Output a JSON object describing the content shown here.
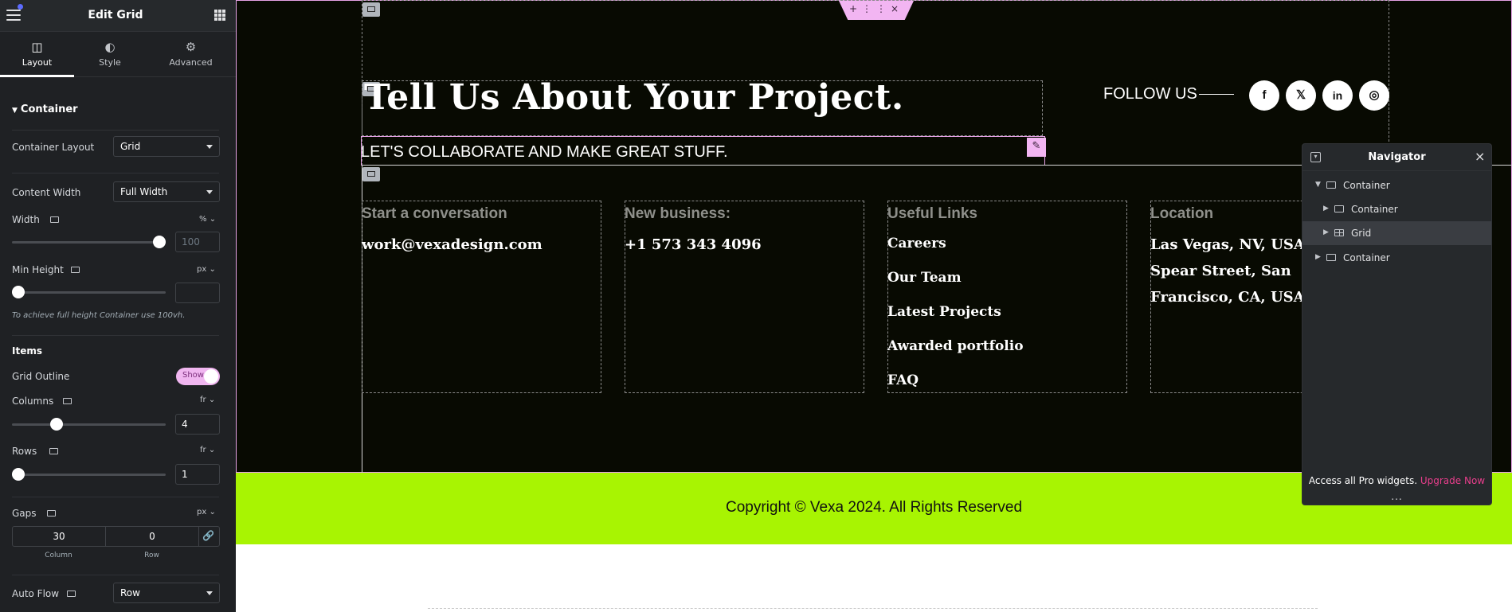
{
  "panel": {
    "title": "Edit Grid",
    "tabs": [
      {
        "label": "Layout",
        "icon": "layout-icon",
        "active": true
      },
      {
        "label": "Style",
        "icon": "style-icon",
        "active": false
      },
      {
        "label": "Advanced",
        "icon": "gear-icon",
        "active": false
      }
    ],
    "section_title": "Container",
    "container_layout": {
      "label": "Container Layout",
      "value": "Grid"
    },
    "content_width": {
      "label": "Content Width",
      "value": "Full Width"
    },
    "width": {
      "label": "Width",
      "unit": "%",
      "placeholder": "100",
      "slider_fraction": 1.0
    },
    "min_height": {
      "label": "Min Height",
      "unit": "px",
      "value": "",
      "slider_fraction": 0.0
    },
    "hint": "To achieve full height Container use 100vh.",
    "items_title": "Items",
    "grid_outline": {
      "label": "Grid Outline",
      "toggle_label": "Show",
      "on": true
    },
    "columns": {
      "label": "Columns",
      "unit": "fr",
      "value": "4",
      "slider_fraction": 0.27
    },
    "rows": {
      "label": "Rows",
      "unit": "fr",
      "value": "1",
      "slider_fraction": 0.0
    },
    "gaps": {
      "label": "Gaps",
      "unit": "px",
      "column_value": "30",
      "row_value": "0",
      "column_label": "Column",
      "row_label": "Row"
    },
    "auto_flow": {
      "label": "Auto Flow",
      "value": "Row"
    }
  },
  "canvas": {
    "headline": "Tell Us About Your Project.",
    "subheadline": "LET'S COLLABORATE AND MAKE GREAT STUFF.",
    "follow_label": "FOLLOW US",
    "socials": [
      {
        "icon": "facebook-icon",
        "glyph": "f"
      },
      {
        "icon": "x-twitter-icon",
        "glyph": "𝕏"
      },
      {
        "icon": "linkedin-icon",
        "glyph": "in"
      },
      {
        "icon": "instagram-icon",
        "glyph": "◎"
      }
    ],
    "columns": [
      {
        "heading": "Start a conversation",
        "items": [
          "work@vexadesign.com"
        ]
      },
      {
        "heading": "New business:",
        "items": [
          "+1 573 343 4096"
        ]
      },
      {
        "heading": "Useful Links",
        "items": [
          "Careers",
          "Our Team",
          "Latest Projects",
          "Awarded portfolio",
          "FAQ"
        ]
      },
      {
        "heading": "Location",
        "items": [
          "Las Vegas, NV, USA",
          "Spear Street, San",
          "Francisco, CA, USA"
        ]
      }
    ],
    "copyright": "Copyright © Vexa 2024. All Rights Reserved",
    "colors": {
      "dark_bg": "#080a02",
      "accent_green": "#a8f402",
      "selection_pink": "#f2b5f2"
    }
  },
  "navigator": {
    "title": "Navigator",
    "tree": [
      {
        "label": "Container",
        "level": 0,
        "expanded": true
      },
      {
        "label": "Container",
        "level": 1,
        "expanded": false
      },
      {
        "label": "Grid",
        "level": 1,
        "expanded": false,
        "selected": true
      },
      {
        "label": "Container",
        "level": 0,
        "expanded": false
      }
    ],
    "promo_text": "Access all Pro widgets.",
    "upgrade_label": "Upgrade Now",
    "more_label": "..."
  }
}
